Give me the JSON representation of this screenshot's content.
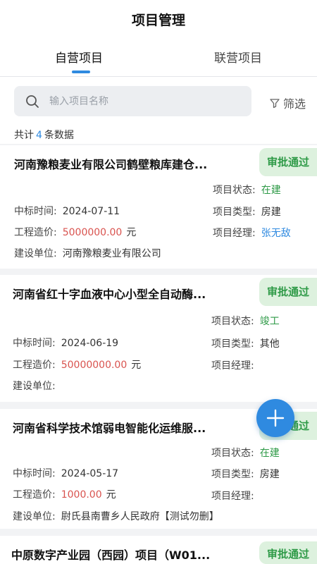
{
  "header": {
    "title": "项目管理",
    "tabs": [
      {
        "label": "自营项目",
        "active": true
      },
      {
        "label": "联营项目",
        "active": false
      }
    ]
  },
  "search": {
    "placeholder": "输入项目名称",
    "filter_label": "筛选"
  },
  "summary": {
    "prefix": "共计",
    "count": "4",
    "suffix": "条数据"
  },
  "labels": {
    "status": "项目状态:",
    "type": "项目类型:",
    "manager": "项目经理:",
    "bid_time": "中标时间:",
    "cost": "工程造价:",
    "builder": "建设单位:",
    "unit": "元"
  },
  "projects": [
    {
      "name": "河南豫粮麦业有限公司鹤壁粮库建仓...",
      "badge": "审批通过",
      "status": "在建",
      "type": "房建",
      "manager": "张无敌",
      "bid_time": "2024-07-11",
      "cost": "5000000.00",
      "builder": "河南豫粮麦业有限公司"
    },
    {
      "name": "河南省红十字血液中心小型全自动酶...",
      "badge": "审批通过",
      "status": "竣工",
      "type": "其他",
      "manager": "",
      "bid_time": "2024-06-19",
      "cost": "50000000.00",
      "builder": ""
    },
    {
      "name": "河南省科学技术馆弱电智能化运维服...",
      "badge": "审批通过",
      "status": "在建",
      "type": "房建",
      "manager": "",
      "bid_time": "2024-05-17",
      "cost": "1000.00",
      "builder": "尉氏县南曹乡人民政府【测试勿删】"
    },
    {
      "name": "中原数字产业园（西园）项目（W01...",
      "badge": "审批通过"
    }
  ],
  "colors": {
    "accent": "#2f8ae0",
    "approved_bg": "#ddf1de",
    "approved_text": "#2e9a47",
    "cost_text": "#d9534f"
  },
  "icons": {
    "search": "search-icon",
    "filter": "filter-icon",
    "fab": "plus-icon"
  }
}
